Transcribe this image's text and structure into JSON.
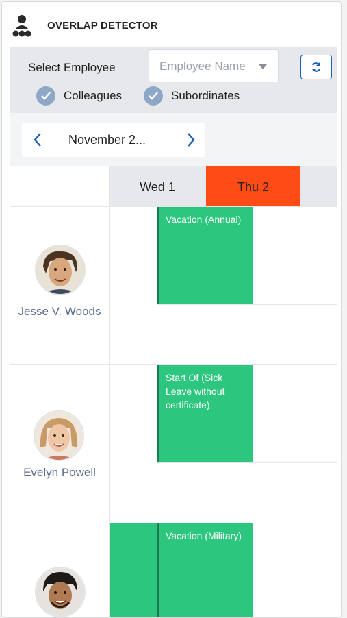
{
  "app": {
    "title": "OVERLAP DETECTOR",
    "icon": "team-icon"
  },
  "filters": {
    "select_label": "Select Employee",
    "employee_placeholder": "Employee Name",
    "refresh_icon": "refresh-icon",
    "checkboxes": [
      {
        "label": "Colleagues",
        "checked": true
      },
      {
        "label": "Subordinates",
        "checked": true
      }
    ]
  },
  "date_nav": {
    "label": "November 2..."
  },
  "days": [
    {
      "label": "Wed 1",
      "highlight": false
    },
    {
      "label": "Thu 2",
      "highlight": true,
      "color": "#ff4b16"
    }
  ],
  "employees": [
    {
      "name": "Jesse V. Woods",
      "events": [
        {
          "label": "Vacation (Annual)"
        }
      ]
    },
    {
      "name": "Evelyn Powell",
      "events": [
        {
          "label": "Start Of (Sick Leave without certificate)"
        }
      ]
    },
    {
      "name": "",
      "events": [
        {
          "label": ""
        },
        {
          "label": "Vacation (Military)"
        }
      ]
    }
  ],
  "colors": {
    "event": "#2dc67f",
    "today": "#ff4b16",
    "accent": "#1b5fb3",
    "name": "#5b6b8a"
  }
}
